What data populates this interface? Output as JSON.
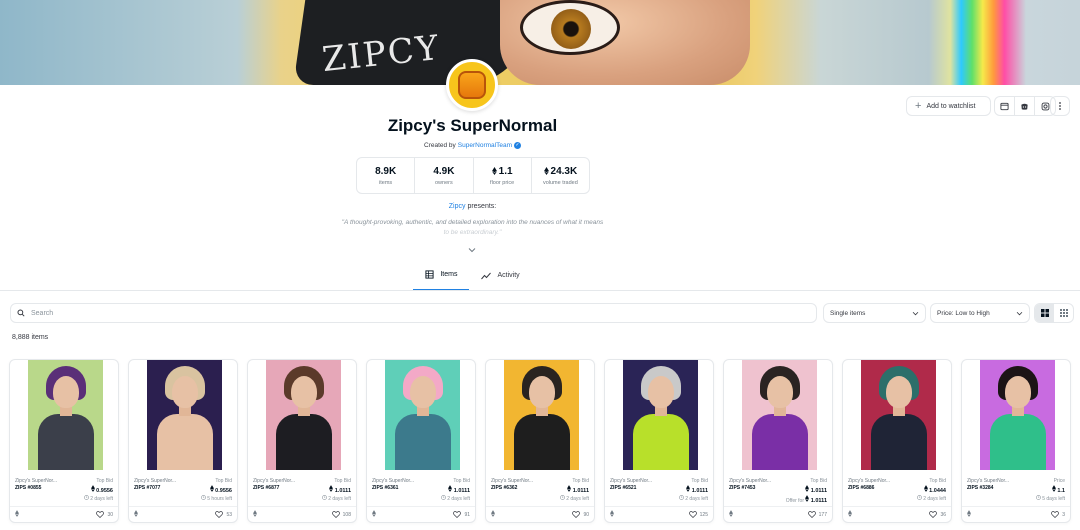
{
  "collection": {
    "name": "Zipcy's SuperNormal",
    "created_by_label": "Created by",
    "creator": "SuperNormalTeam",
    "presents_author": "Zipcy",
    "presents_label": "presents:",
    "description_line1": "\"A thought-provoking, authentic, and detailed exploration into the nuances of what it means",
    "description_line2": "to be extraordinary.\""
  },
  "banner": {
    "mask_text": "ZIPCY"
  },
  "actions": {
    "watchlist": "Add to watchlist"
  },
  "stats": [
    {
      "value": "8.9K",
      "label": "items",
      "eth": false
    },
    {
      "value": "4.9K",
      "label": "owners",
      "eth": false
    },
    {
      "value": "1.1",
      "label": "floor price",
      "eth": true
    },
    {
      "value": "24.3K",
      "label": "volume traded",
      "eth": true
    }
  ],
  "tabs": {
    "items": "Items",
    "activity": "Activity"
  },
  "filters": {
    "search_placeholder": "Search",
    "type_select": "Single items",
    "sort_select": "Price: Low to High"
  },
  "items_count": "8,888 items",
  "cards": [
    {
      "collection": "Zipcy's SuperNor...",
      "name": "ZIPS #0855",
      "label": "Top Bid",
      "price": "0.9556",
      "sub": "2 days left",
      "likes": "30",
      "bg": "#b9d88a",
      "hair": "#5a2f78",
      "body": "#3b3f4a"
    },
    {
      "collection": "Zipcy's SuperNor...",
      "name": "ZIPS #7077",
      "label": "Top Bid",
      "price": "0.9556",
      "sub": "5 hours left",
      "likes": "53",
      "bg": "#2b1f4f",
      "hair": "#d9c3a0",
      "body": "#e7c1a5"
    },
    {
      "collection": "Zipcy's SuperNor...",
      "name": "ZIPS #6877",
      "label": "Top Bid",
      "price": "1.0111",
      "sub": "2 days left",
      "likes": "108",
      "bg": "#e6a7b8",
      "hair": "#5b3a2a",
      "body": "#1d1d22"
    },
    {
      "collection": "Zipcy's SuperNor...",
      "name": "ZIPS #6361",
      "label": "Top Bid",
      "price": "1.0111",
      "sub": "2 days left",
      "likes": "91",
      "bg": "#5fcfb8",
      "hair": "#f3a9c7",
      "body": "#3c7a8c"
    },
    {
      "collection": "Zipcy's SuperNor...",
      "name": "ZIPS #6362",
      "label": "Top Bid",
      "price": "1.0111",
      "sub": "2 days left",
      "likes": "90",
      "bg": "#f2b631",
      "hair": "#2a2420",
      "body": "#1e1e1e"
    },
    {
      "collection": "Zipcy's SuperNor...",
      "name": "ZIPS #6521",
      "label": "Top Bid",
      "price": "1.0111",
      "sub": "2 days left",
      "likes": "125",
      "bg": "#2a2456",
      "hair": "#c9c9c9",
      "body": "#b8e02a"
    },
    {
      "collection": "Zipcy's SuperNor...",
      "name": "ZIPS #7453",
      "label": "Top Bid",
      "price": "1.0111",
      "sub": "Offer for",
      "sub_price": "1.0111",
      "likes": "177",
      "bg": "#efc2cf",
      "hair": "#2a2322",
      "body": "#7a2fa6"
    },
    {
      "collection": "Zipcy's SuperNor...",
      "name": "ZIPS #6886",
      "label": "Top Bid",
      "price": "1.0444",
      "sub": "2 days left",
      "likes": "36",
      "bg": "#b02a4a",
      "hair": "#2c6f6a",
      "body": "#1f2436"
    },
    {
      "collection": "Zipcy's SuperNor...",
      "name": "ZIPS #3284",
      "label": "Price",
      "price": "1.1",
      "sub": "5 days left",
      "likes": "3",
      "bg": "#c86be0",
      "hair": "#1c1416",
      "body": "#2fbf8a"
    }
  ]
}
